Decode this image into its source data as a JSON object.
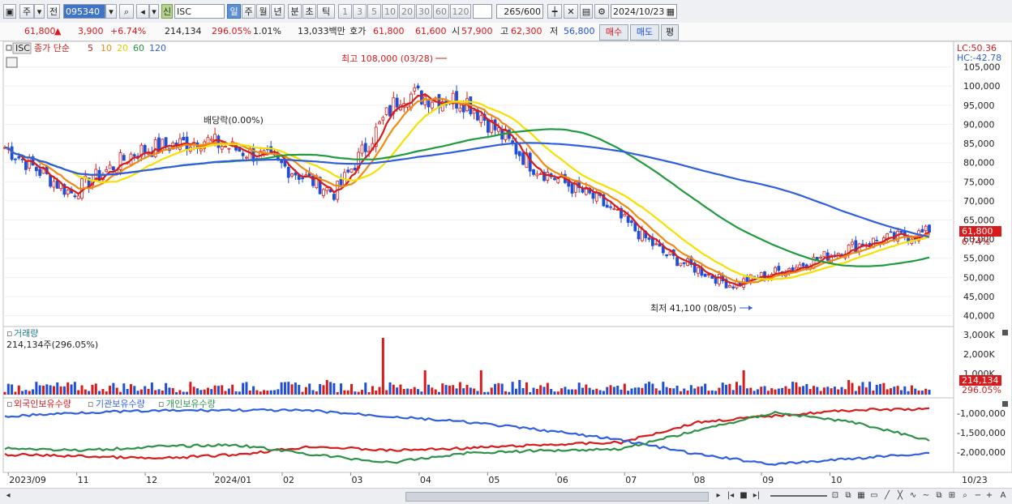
{
  "toolbar": {
    "market": "주",
    "market2": "전",
    "code": "095340",
    "flag": "신",
    "name": "ISC",
    "periods": [
      "일",
      "주",
      "월",
      "년",
      "분",
      "초",
      "틱"
    ],
    "periods_selected": "일",
    "ticks": [
      "1",
      "3",
      "5",
      "10",
      "20",
      "30",
      "60",
      "120"
    ],
    "count": "265",
    "count_total": "/600",
    "date": "2024/10/23"
  },
  "quote": {
    "price": "61,800",
    "arrow": "▲",
    "change": "3,900",
    "change_pct": "+6.74%",
    "volume": "214,134",
    "volume_pct": "296.05%",
    "turnover": "1.01%",
    "amount": "13,033백만",
    "hoga_label": "호가",
    "ask": "61,800",
    "bid": "61,600",
    "open_label": "시",
    "open": "57,900",
    "high_label": "고",
    "high": "62,300",
    "low_label": "저",
    "low": "56,800",
    "buy_label": "매수",
    "sell_label": "매도",
    "eval_label": "평"
  },
  "price_panel": {
    "symbol": "ISC",
    "legend_prefix": "종가 단순",
    "ma_labels": [
      "5",
      "10",
      "20",
      "60",
      "120"
    ],
    "ma_colors": [
      "#d81a1a",
      "#f08a10",
      "#f5e000",
      "#1e9b3c",
      "#2f5fe0"
    ],
    "lc": "LC:50.36",
    "hc": "HC:-42.78",
    "high_note": "최고 108,000 (03/28)",
    "low_note": "최저 41,100 (08/05)",
    "dividend_note": "배당락(0.00%)",
    "last_price": "61,800",
    "last_pct": "6.74%",
    "yticks": [
      "105,000",
      "100,000",
      "95,000",
      "90,000",
      "85,000",
      "80,000",
      "75,000",
      "70,000",
      "65,000",
      "60,000",
      "55,000",
      "50,000",
      "45,000",
      "40,000"
    ]
  },
  "volume_panel": {
    "title": "거래량",
    "value": "214,134주(296.05%)",
    "yticks": [
      "3,000K",
      "2,000K",
      "1,000K"
    ],
    "last_value": "214,134",
    "last_pct": "296.05%"
  },
  "holding_panel": {
    "series": [
      "외국인보유수량",
      "기관보유수량",
      "개인보유수량"
    ],
    "colors": [
      "#d81a1a",
      "#2f5fe0",
      "#2e9148"
    ],
    "yticks": [
      "-1,000,000",
      "-1,500,000",
      "-2,000,000"
    ]
  },
  "xaxis": {
    "labels": [
      "2023/09",
      "11",
      "12",
      "2024/01",
      "02",
      "03",
      "04",
      "05",
      "06",
      "07",
      "08",
      "09",
      "10"
    ],
    "last_label": "10/23"
  },
  "chart_data": {
    "type": "line",
    "title": "ISC",
    "x_start": "2023/09",
    "x_end": "2024/10/23",
    "ylim": [
      38000,
      110000
    ],
    "series": [
      {
        "name": "5",
        "values": []
      },
      {
        "name": "20",
        "values": []
      }
    ],
    "close_anchors": [
      [
        "2023/09",
        84000
      ],
      [
        "2023/10",
        72000
      ],
      [
        "2023/11",
        83000
      ],
      [
        "2023/12",
        86000
      ],
      [
        "2024/01",
        81000
      ],
      [
        "2024/02",
        72000
      ],
      [
        "2024/03",
        98000
      ],
      [
        "2024/04",
        96000
      ],
      [
        "2024/05",
        79000
      ],
      [
        "2024/06",
        70000
      ],
      [
        "2024/07",
        56000
      ],
      [
        "2024/08",
        48000
      ],
      [
        "2024/09",
        53000
      ],
      [
        "2024/10",
        59000
      ],
      [
        "2024/10/23",
        61800
      ]
    ],
    "high": 108000,
    "low": 41100
  }
}
